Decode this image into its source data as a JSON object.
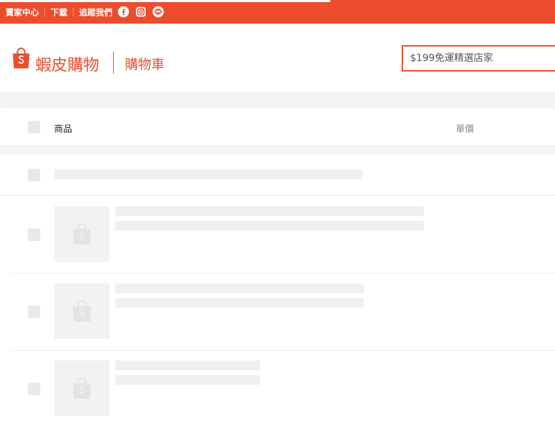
{
  "topbar": {
    "links": [
      "賣家中心",
      "下載",
      "追蹤我們"
    ],
    "social": [
      "facebook-icon",
      "instagram-icon",
      "line-icon"
    ],
    "color": "#ee4d2d"
  },
  "header": {
    "logo_text": "蝦皮購物",
    "page_title": "購物車",
    "search_placeholder": "$199免運精選店家"
  },
  "cart_header": {
    "product_label": "商品",
    "unit_price_label": "單價"
  },
  "skeleton_items": 3
}
